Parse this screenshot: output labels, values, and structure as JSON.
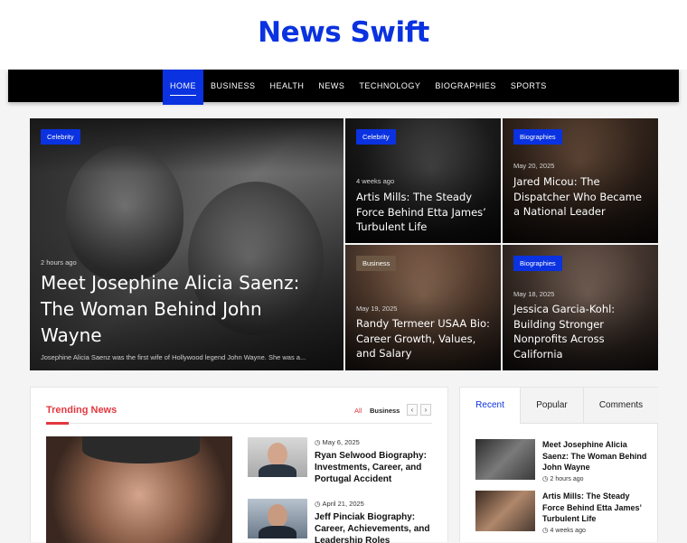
{
  "site": {
    "title": "News Swift"
  },
  "nav": {
    "items": [
      "Home",
      "Business",
      "Health",
      "News",
      "Technology",
      "Biographies",
      "Sports"
    ]
  },
  "featured": {
    "main": {
      "category": "Celebrity",
      "time": "2 hours ago",
      "title": "Meet Josephine Alicia Saenz: The Woman Behind John Wayne",
      "excerpt": "Josephine Alicia Saenz was the first wife of Hollywood legend John Wayne. She was a..."
    },
    "cards": [
      {
        "category": "Celebrity",
        "time": "4 weeks ago",
        "title": "Artis Mills: The Steady Force Behind Etta James’ Turbulent Life"
      },
      {
        "category": "Biographies",
        "time": "May 20, 2025",
        "title": "Jared Micou: The Dispatcher Who Became a National Leader"
      },
      {
        "category": "Business",
        "time": "May 19, 2025",
        "title": "Randy Termeer USAA Bio: Career Growth, Values, and Salary"
      },
      {
        "category": "Biographies",
        "time": "May 18, 2025",
        "title": "Jessica Garcia-Kohl: Building Stronger Nonprofits Across California"
      }
    ]
  },
  "trending": {
    "heading": "Trending News",
    "filters": [
      "All",
      "Business"
    ],
    "prev_icon": "‹",
    "next_icon": "›",
    "items": [
      {
        "date": "May 6, 2025",
        "title": "Ryan Selwood Biography: Investments, Career, and Portugal Accident"
      },
      {
        "date": "April 21, 2025",
        "title": "Jeff Pinciak Biography: Career, Achievements, and Leadership Roles"
      }
    ]
  },
  "sidebar": {
    "tabs": [
      "Recent",
      "Popular",
      "Comments"
    ],
    "items": [
      {
        "title": "Meet Josephine Alicia Saenz: The Woman Behind John Wayne",
        "time": "2 hours ago"
      },
      {
        "title": "Artis Mills: The Steady Force Behind Etta James’ Turbulent Life",
        "time": "4 weeks ago"
      }
    ]
  },
  "colors": {
    "brand": "#0a32e0",
    "accent_red": "#e2383f",
    "nav_bg": "#000000"
  }
}
